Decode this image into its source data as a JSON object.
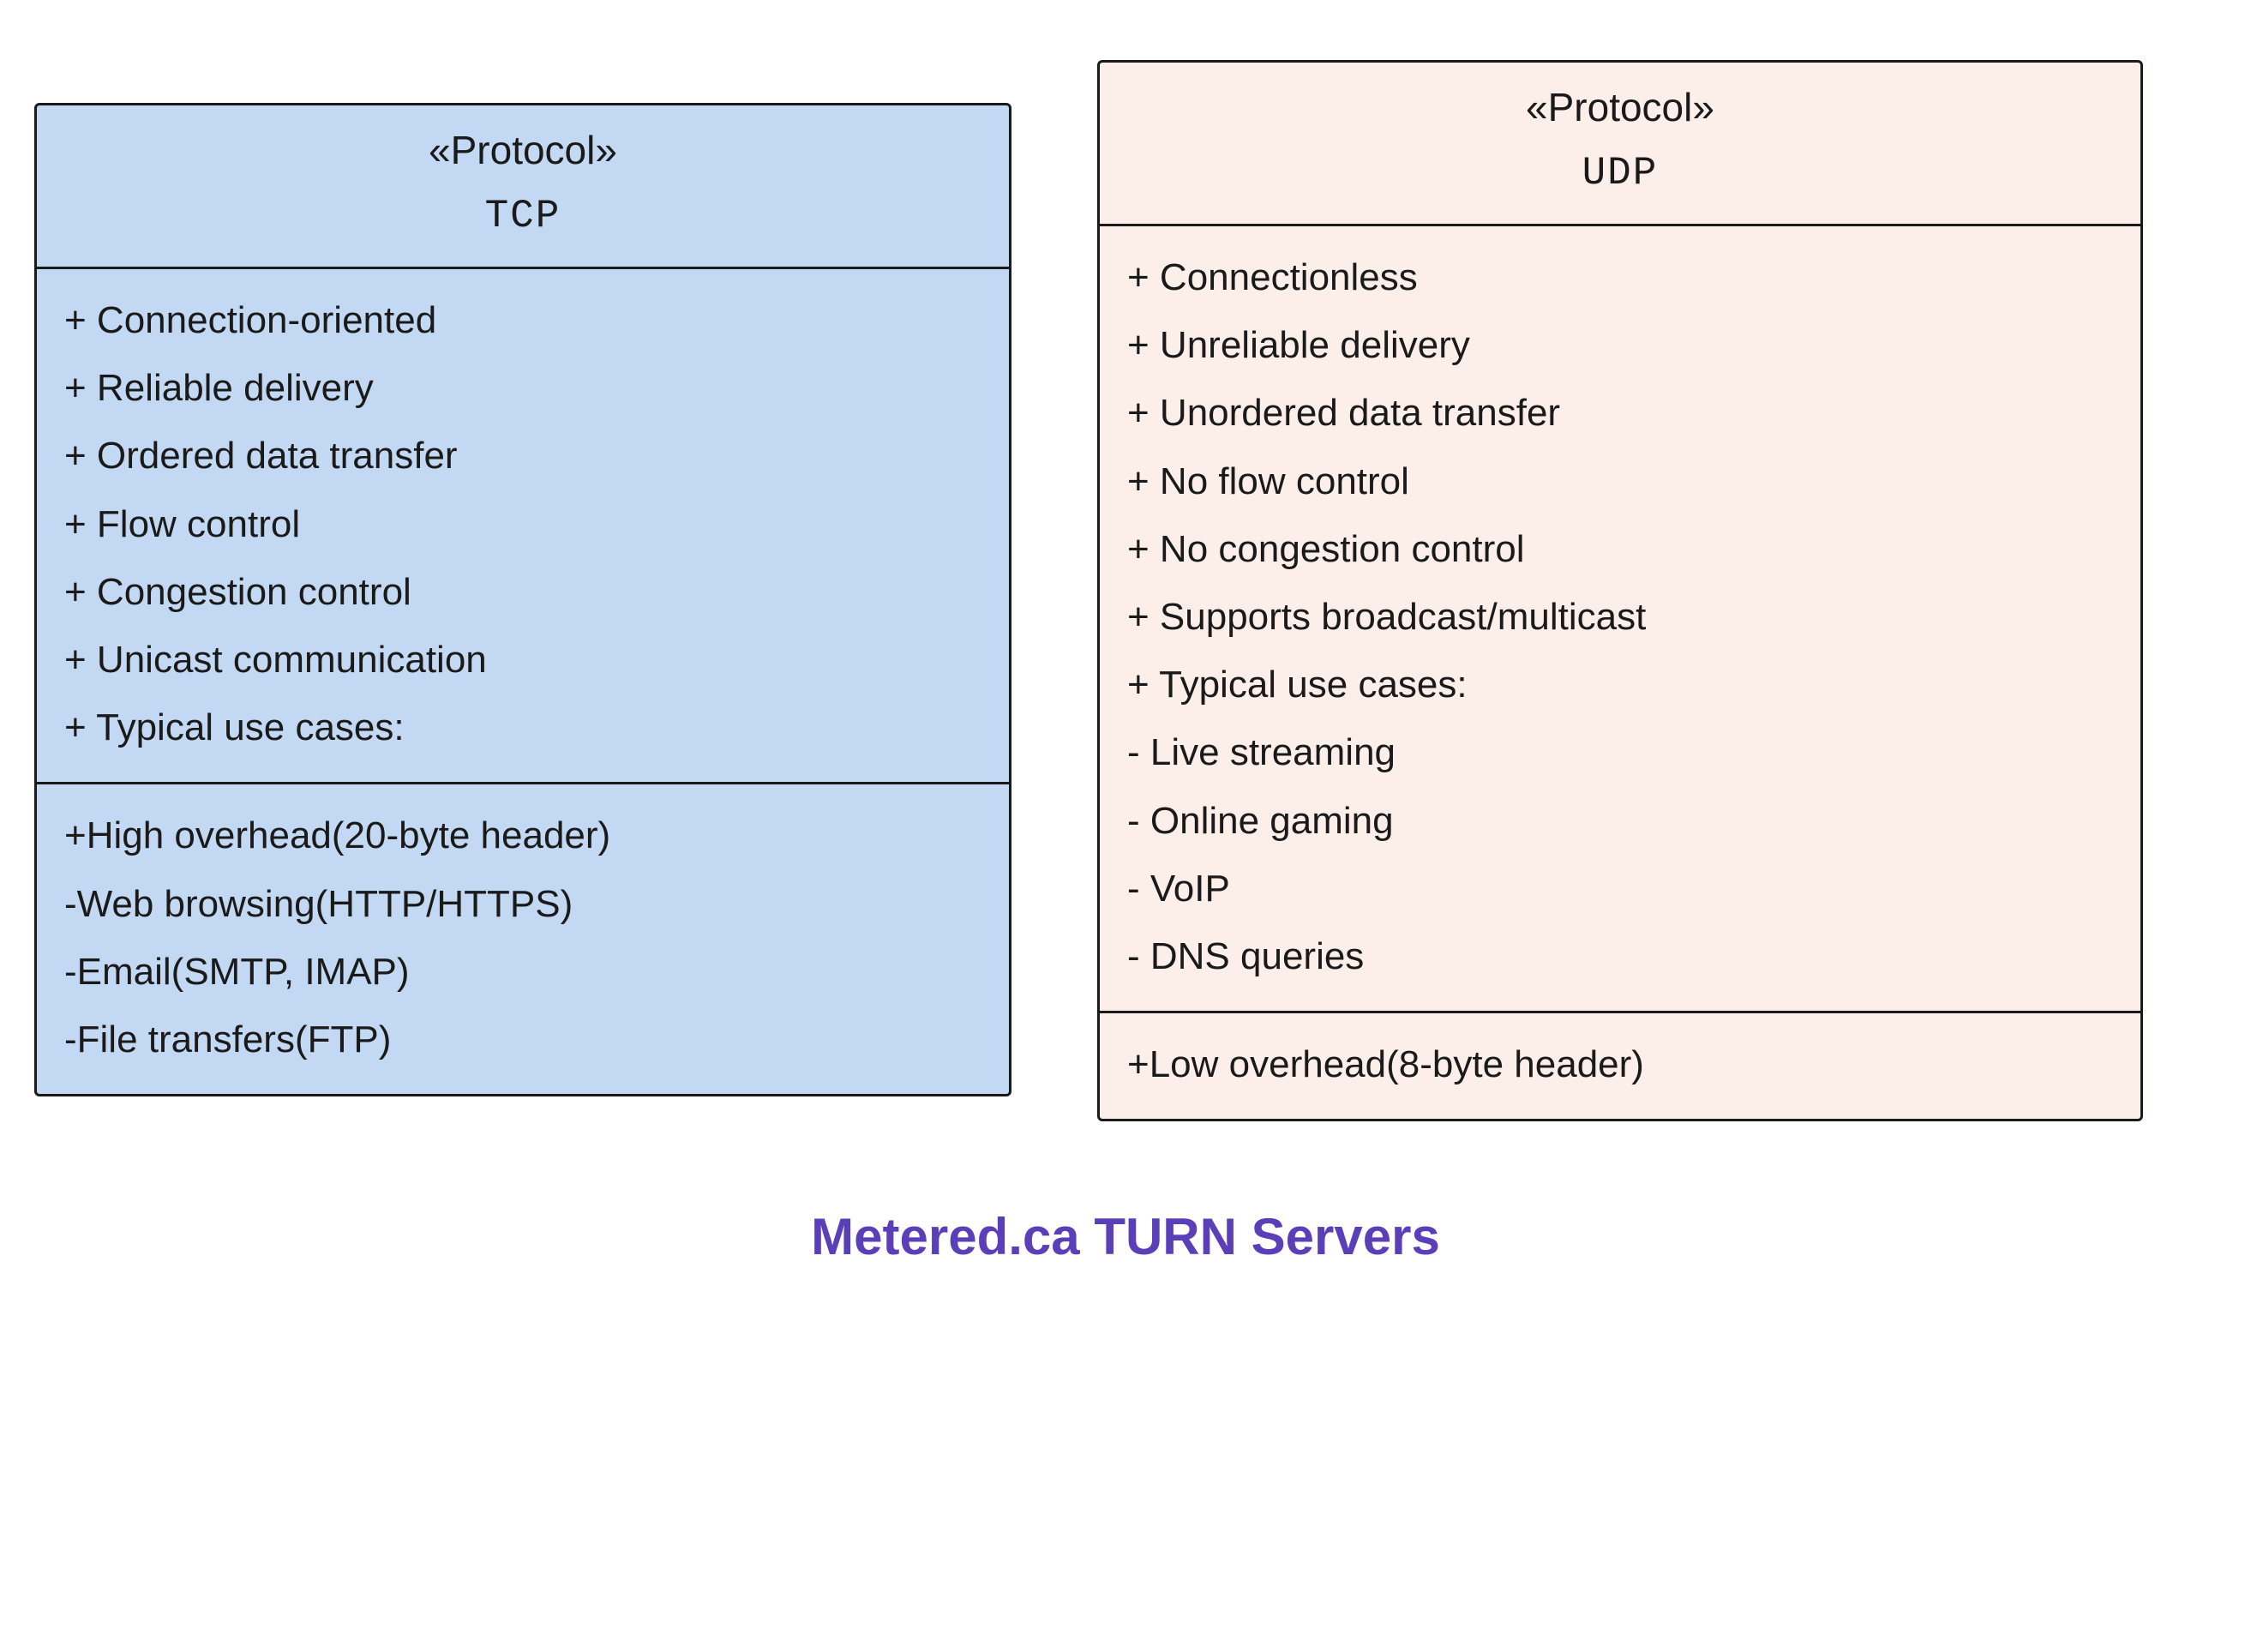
{
  "tcp": {
    "stereotype": "«Protocol»",
    "name": "TCP",
    "section1": [
      "+ Connection-oriented",
      "+ Reliable delivery",
      "+ Ordered data transfer",
      "+ Flow control",
      "+ Congestion control",
      "+ Unicast communication",
      "+ Typical use cases:"
    ],
    "section2": [
      "+High overhead(20-byte header)",
      "-Web browsing(HTTP/HTTPS)",
      "-Email(SMTP, IMAP)",
      "-File transfers(FTP)"
    ]
  },
  "udp": {
    "stereotype": "«Protocol»",
    "name": "UDP",
    "section1": [
      "+ Connectionless",
      "+ Unreliable delivery",
      "+ Unordered data transfer",
      "+ No flow control",
      "+ No congestion control",
      "+ Supports broadcast/multicast",
      "+ Typical use cases:",
      "- Live streaming",
      "- Online gaming",
      "- VoIP",
      "- DNS queries"
    ],
    "section2": [
      "+Low overhead(8-byte header)"
    ]
  },
  "footer": "Metered.ca TURN Servers"
}
